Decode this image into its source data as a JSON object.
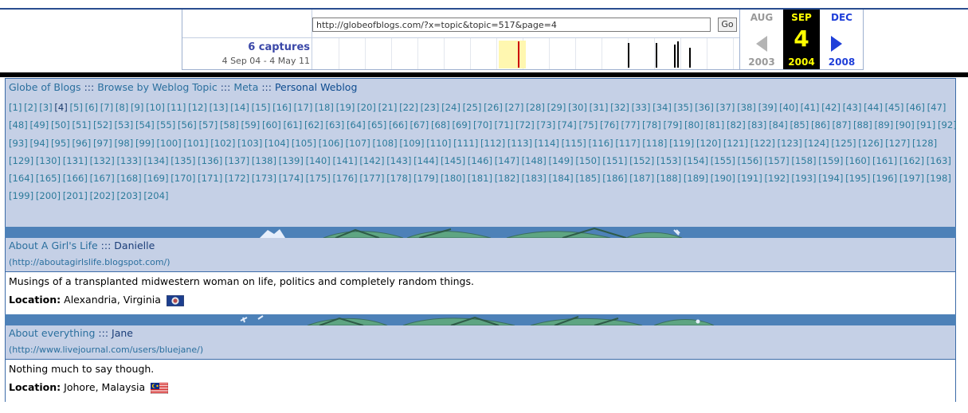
{
  "wayback": {
    "url": "http://globeofblogs.com/?x=topic&topic=517&page=4",
    "go_label": "Go",
    "captures": "6 captures",
    "capture_range": "4 Sep 04 - 4 May 11",
    "prev_month": "AUG",
    "cur_month": "SEP",
    "next_month": "DEC",
    "cur_day": "4",
    "prev_year": "2003",
    "cur_year": "2004",
    "next_year": "2008",
    "colors": {
      "accent": "#1f3fd9",
      "current": "#ffff00",
      "highlight": "#cc0000"
    }
  },
  "breadcrumb": {
    "site": "Globe of Blogs",
    "browse": "Browse by Weblog Topic",
    "meta": "Meta",
    "current": "Personal Weblog",
    "separator": ":::"
  },
  "pagination": {
    "current_page": 4,
    "total_pages": 204
  },
  "entries": [
    {
      "title": "About A Girl's Life",
      "separator": ":::",
      "author": "Danielle",
      "url": "(http://aboutagirlslife.blogspot.com/)",
      "description": "Musings of a transplanted midwestern woman on life, politics and completely random things.",
      "location_label": "Location:",
      "location": "Alexandria, Virginia",
      "flag_icon": "virginia-flag-icon"
    },
    {
      "title": "About everything",
      "separator": ":::",
      "author": "Jane",
      "url": "(http://www.livejournal.com/users/bluejane/)",
      "description": "Nothing much to say though.",
      "location_label": "Location:",
      "location": "Johore, Malaysia",
      "flag_icon": "malaysia-flag-icon"
    }
  ],
  "colors": {
    "panel_bg": "#c5d0e6",
    "link": "#2a6f9e",
    "border": "#3c6ba8"
  }
}
